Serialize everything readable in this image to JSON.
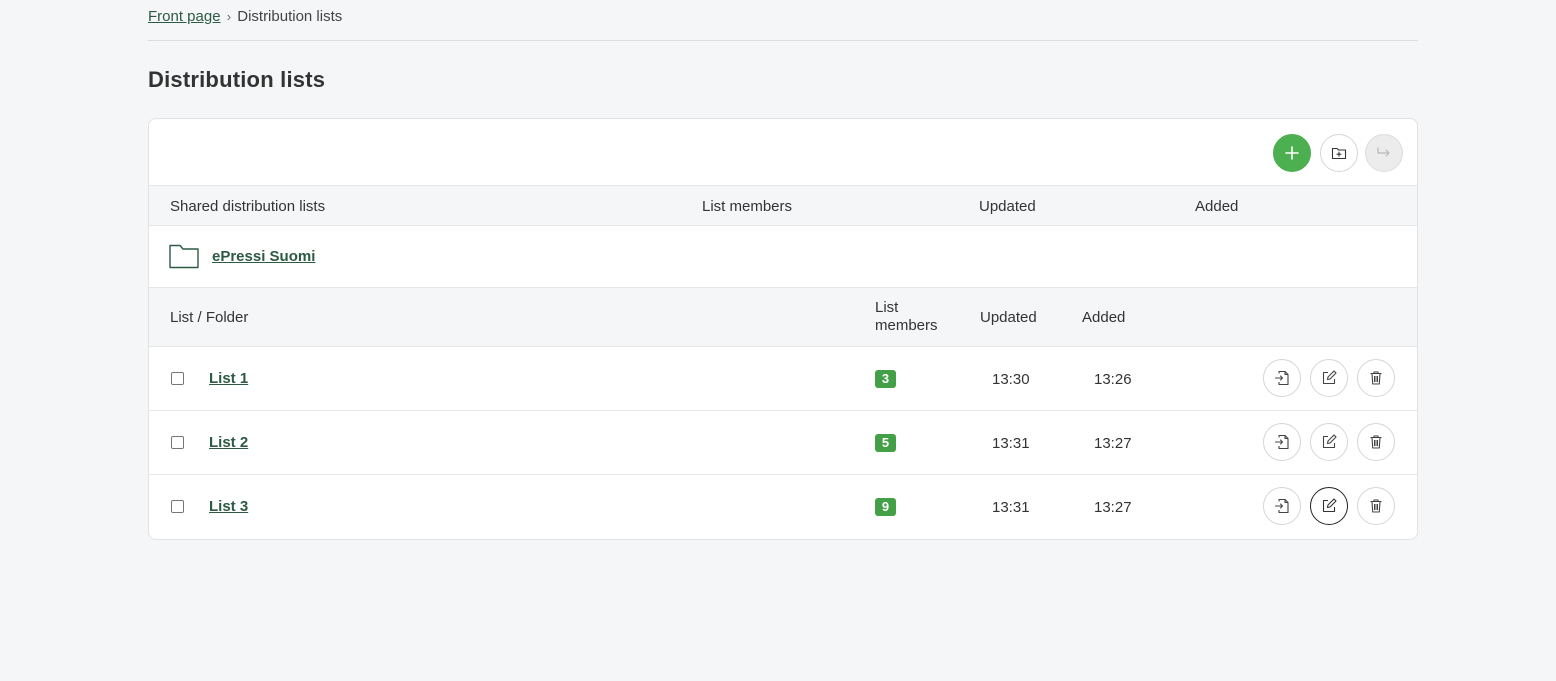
{
  "breadcrumb": {
    "home_label": "Front page",
    "separator": "›",
    "current_label": "Distribution lists"
  },
  "page_title": "Distribution lists",
  "toolbar": {
    "add_icon": "plus-icon",
    "new_folder_icon": "folder-plus-icon",
    "move_icon": "move-arrow-icon"
  },
  "shared_table": {
    "headers": {
      "name": "Shared distribution lists",
      "members": "List members",
      "updated": "Updated",
      "added": "Added"
    },
    "folders": [
      {
        "name": "ePressi Suomi"
      }
    ]
  },
  "lists_table": {
    "headers": {
      "name": "List / Folder",
      "members": "List members",
      "updated": "Updated",
      "added": "Added"
    },
    "rows": [
      {
        "name": "List 1",
        "members": "3",
        "updated": "13:30",
        "added": "13:26"
      },
      {
        "name": "List 2",
        "members": "5",
        "updated": "13:31",
        "added": "13:27"
      },
      {
        "name": "List 3",
        "members": "9",
        "updated": "13:31",
        "added": "13:27"
      }
    ]
  },
  "colors": {
    "accent_green": "#4caf50",
    "badge_green": "#43a047",
    "link_green": "#2d5a44"
  }
}
